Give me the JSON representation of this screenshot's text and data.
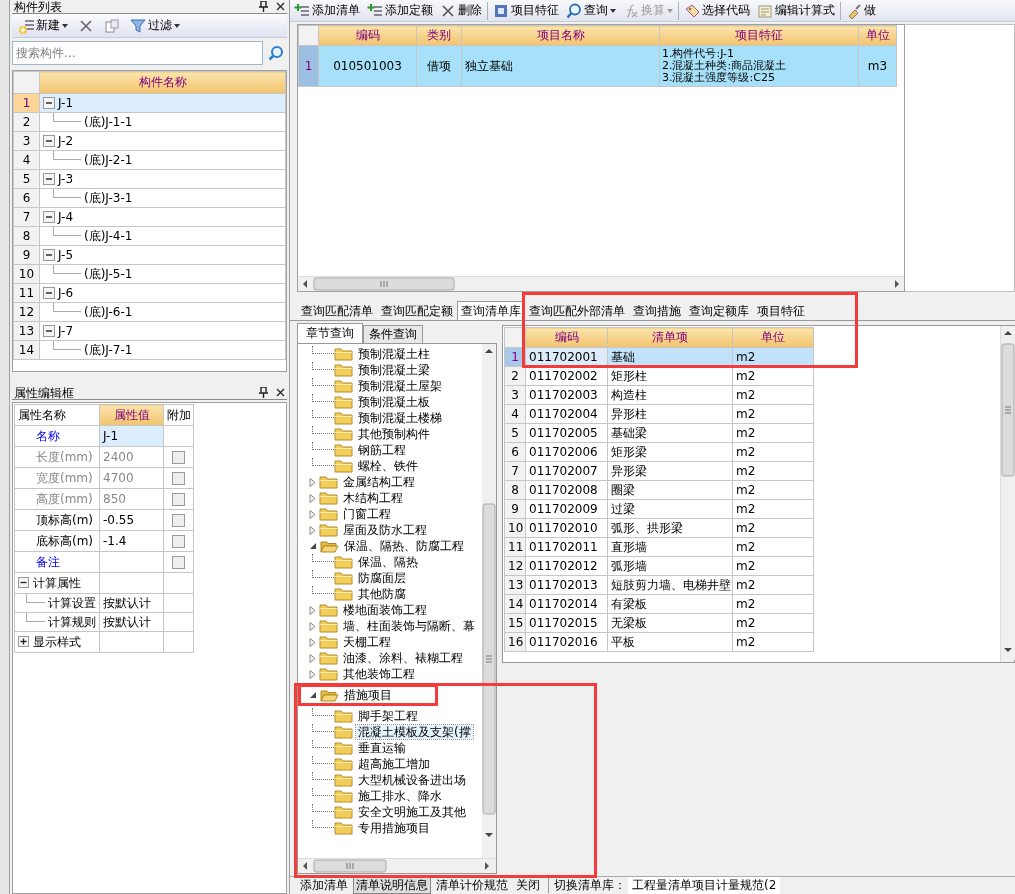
{
  "component_panel": {
    "title": "构件列表",
    "toolbar": [
      {
        "kind": "new",
        "label": "新建",
        "dropdown": true
      },
      {
        "kind": "delete"
      },
      {
        "kind": "copy"
      },
      {
        "kind": "filter",
        "label": "过滤",
        "dropdown": true
      }
    ],
    "search": {
      "placeholder": "搜索构件..."
    },
    "columns": [
      "构件名称"
    ],
    "rows": [
      {
        "row": "1",
        "name": "J-1",
        "expanded": true,
        "selected": true,
        "children": [
          {
            "row": "2",
            "name": "(底)J-1-1",
            "selected": false
          }
        ]
      },
      {
        "row": "3",
        "name": "J-2",
        "expanded": true,
        "selected": false,
        "children": [
          {
            "row": "4",
            "name": "(底)J-2-1",
            "selected": false
          }
        ]
      },
      {
        "row": "5",
        "name": "J-3",
        "expanded": true,
        "selected": false,
        "children": [
          {
            "row": "6",
            "name": "(底)J-3-1",
            "selected": false
          }
        ]
      },
      {
        "row": "7",
        "name": "J-4",
        "expanded": true,
        "selected": false,
        "children": [
          {
            "row": "8",
            "name": "(底)J-4-1",
            "selected": false
          }
        ]
      },
      {
        "row": "9",
        "name": "J-5",
        "expanded": true,
        "selected": false,
        "children": [
          {
            "row": "10",
            "name": "(底)J-5-1",
            "selected": false
          }
        ]
      },
      {
        "row": "11",
        "name": "J-6",
        "expanded": true,
        "selected": false,
        "children": [
          {
            "row": "12",
            "name": "(底)J-6-1",
            "selected": false
          }
        ]
      },
      {
        "row": "13",
        "name": "J-7",
        "expanded": true,
        "selected": false,
        "children": [
          {
            "row": "14",
            "name": "(底)J-7-1",
            "selected": false
          }
        ]
      }
    ]
  },
  "property_panel": {
    "title": "属性编辑框",
    "columns": [
      {
        "label": "属性名称",
        "selected": false
      },
      {
        "label": "属性值",
        "selected": true
      },
      {
        "label": "附加",
        "selected": false
      }
    ],
    "rows": [
      {
        "kind": "public",
        "name": "名称",
        "value": "J-1",
        "selected": true
      },
      {
        "kind": "locked",
        "name": "长度(mm)",
        "value": "2400",
        "checked": false,
        "selected": false
      },
      {
        "kind": "locked",
        "name": "宽度(mm)",
        "value": "4700",
        "checked": false,
        "selected": false
      },
      {
        "kind": "locked",
        "name": "高度(mm)",
        "value": "850",
        "checked": false,
        "selected": false
      },
      {
        "kind": "private",
        "name": "顶标高(m)",
        "value": "-0.55",
        "checked": false,
        "selected": false
      },
      {
        "kind": "private",
        "name": "底标高(m)",
        "value": "-1.4",
        "checked": false,
        "selected": false
      },
      {
        "kind": "public",
        "name": "备注",
        "checked": false,
        "selected": false
      },
      {
        "kind": "group",
        "name": "计算属性",
        "expanded": true,
        "selected": false,
        "children": [
          {
            "name": "计算设置",
            "value": "按默认计"
          },
          {
            "name": "计算规则",
            "value": "按默认计"
          }
        ]
      },
      {
        "kind": "group",
        "name": "显示样式",
        "expanded": false,
        "selected": false
      }
    ]
  },
  "main_toolbar": [
    {
      "kind": "add-list",
      "label": "添加清单",
      "disabled": false
    },
    {
      "kind": "add-quota",
      "label": "添加定额",
      "disabled": false
    },
    {
      "kind": "delete",
      "label": "删除",
      "disabled": false
    },
    {
      "kind": "features",
      "label": "项目特征",
      "disabled": false
    },
    {
      "kind": "query",
      "label": "查询",
      "dropdown": true,
      "disabled": false
    },
    {
      "kind": "convert",
      "label": "换算",
      "dropdown": true,
      "disabled": true
    },
    {
      "kind": "choose-code",
      "label": "选择代码",
      "disabled": false
    },
    {
      "kind": "edit-formula",
      "label": "编辑计算式",
      "disabled": false
    },
    {
      "kind": "do",
      "label": "做",
      "disabled": false
    }
  ],
  "bill_table": {
    "columns": [
      "编码",
      "类别",
      "项目名称",
      "项目特征",
      "单位"
    ],
    "rows": [
      {
        "row": "1",
        "code": "010501003",
        "category": "借项",
        "name": "独立基础",
        "features": [
          "1.构件代号:J-1",
          "2.混凝土种类:商品混凝土",
          "3.混凝土强度等级:C25"
        ],
        "unit": "m3",
        "selected": true
      }
    ]
  },
  "query_tabs": [
    {
      "label": "查询匹配清单",
      "selected": false
    },
    {
      "label": "查询匹配定额",
      "selected": false
    },
    {
      "label": "查询清单库",
      "selected": true
    },
    {
      "label": "查询匹配外部清单",
      "selected": false
    },
    {
      "label": "查询措施",
      "selected": false
    },
    {
      "label": "查询定额库",
      "selected": false
    },
    {
      "label": "项目特征",
      "selected": false
    }
  ],
  "chapter_tabs": [
    {
      "label": "章节查询",
      "selected": true
    },
    {
      "label": "条件查询",
      "selected": false
    }
  ],
  "chapter_tree": {
    "continued_children": [
      {
        "label": "预制混凝土柱",
        "selected": false
      },
      {
        "label": "预制混凝土梁",
        "selected": false
      },
      {
        "label": "预制混凝土屋架",
        "selected": false
      },
      {
        "label": "预制混凝土板",
        "selected": false
      },
      {
        "label": "预制混凝土楼梯",
        "selected": false
      },
      {
        "label": "其他预制构件",
        "selected": false
      },
      {
        "label": "钢筋工程",
        "selected": false
      },
      {
        "label": "螺栓、铁件",
        "selected": false
      }
    ],
    "items": [
      {
        "label": "金属结构工程",
        "expanded": false,
        "selected": false
      },
      {
        "label": "木结构工程",
        "expanded": false,
        "selected": false
      },
      {
        "label": "门窗工程",
        "expanded": false,
        "selected": false
      },
      {
        "label": "屋面及防水工程",
        "expanded": false,
        "selected": false
      },
      {
        "label": "保温、隔热、防腐工程",
        "expanded": true,
        "selected": false,
        "children": [
          {
            "label": "保温、隔热",
            "selected": false
          },
          {
            "label": "防腐面层",
            "selected": false
          },
          {
            "label": "其他防腐",
            "selected": false
          }
        ]
      },
      {
        "label": "楼地面装饰工程",
        "expanded": false,
        "selected": false
      },
      {
        "label": "墙、柱面装饰与隔断、幕",
        "expanded": false,
        "selected": false
      },
      {
        "label": "天棚工程",
        "expanded": false,
        "selected": false
      },
      {
        "label": "油漆、涂料、裱糊工程",
        "expanded": false,
        "selected": false
      },
      {
        "label": "其他装饰工程",
        "expanded": false,
        "selected": false
      },
      {
        "label": "措施项目",
        "expanded": true,
        "selected": false,
        "children": [
          {
            "label": "脚手架工程",
            "selected": false
          },
          {
            "label": "混凝土模板及支架(撑",
            "selected": true
          },
          {
            "label": "垂直运输",
            "selected": false
          },
          {
            "label": "超高施工增加",
            "selected": false
          },
          {
            "label": "大型机械设备进出场",
            "selected": false
          },
          {
            "label": "施工排水、降水",
            "selected": false
          },
          {
            "label": "安全文明施工及其他",
            "selected": false
          },
          {
            "label": "专用措施项目",
            "selected": false
          }
        ]
      }
    ]
  },
  "library_table": {
    "columns": [
      "编码",
      "清单项",
      "单位"
    ],
    "rows": [
      {
        "row": "1",
        "code": "011702001",
        "item": "基础",
        "unit": "m2",
        "selected": true
      },
      {
        "row": "2",
        "code": "011702002",
        "item": "矩形柱",
        "unit": "m2",
        "selected": false
      },
      {
        "row": "3",
        "code": "011702003",
        "item": "构造柱",
        "unit": "m2",
        "selected": false
      },
      {
        "row": "4",
        "code": "011702004",
        "item": "异形柱",
        "unit": "m2",
        "selected": false
      },
      {
        "row": "5",
        "code": "011702005",
        "item": "基础梁",
        "unit": "m2",
        "selected": false
      },
      {
        "row": "6",
        "code": "011702006",
        "item": "矩形梁",
        "unit": "m2",
        "selected": false
      },
      {
        "row": "7",
        "code": "011702007",
        "item": "异形梁",
        "unit": "m2",
        "selected": false
      },
      {
        "row": "8",
        "code": "011702008",
        "item": "圈梁",
        "unit": "m2",
        "selected": false
      },
      {
        "row": "9",
        "code": "011702009",
        "item": "过梁",
        "unit": "m2",
        "selected": false
      },
      {
        "row": "10",
        "code": "011702010",
        "item": "弧形、拱形梁",
        "unit": "m2",
        "selected": false
      },
      {
        "row": "11",
        "code": "011702011",
        "item": "直形墙",
        "unit": "m2",
        "selected": false
      },
      {
        "row": "12",
        "code": "011702012",
        "item": "弧形墙",
        "unit": "m2",
        "selected": false
      },
      {
        "row": "13",
        "code": "011702013",
        "item": "短肢剪力墙、电梯井壁",
        "unit": "m2",
        "selected": false
      },
      {
        "row": "14",
        "code": "011702014",
        "item": "有梁板",
        "unit": "m2",
        "selected": false
      },
      {
        "row": "15",
        "code": "011702015",
        "item": "无梁板",
        "unit": "m2",
        "selected": false
      },
      {
        "row": "16",
        "code": "011702016",
        "item": "平板",
        "unit": "m2",
        "selected": false
      }
    ]
  },
  "bottom_bar": {
    "buttons": [
      {
        "label": "添加清单",
        "selected": false
      },
      {
        "label": "清单说明信息",
        "selected": true
      },
      {
        "label": "清单计价规范",
        "selected": false
      },
      {
        "label": "关闭",
        "selected": false
      }
    ],
    "library_label": "切换清单库：",
    "library_value": "工程量清单项目计量规范(2"
  },
  "annotations": [
    {
      "kind": "frame"
    },
    {
      "kind": "frame"
    },
    {
      "kind": "frame"
    }
  ]
}
